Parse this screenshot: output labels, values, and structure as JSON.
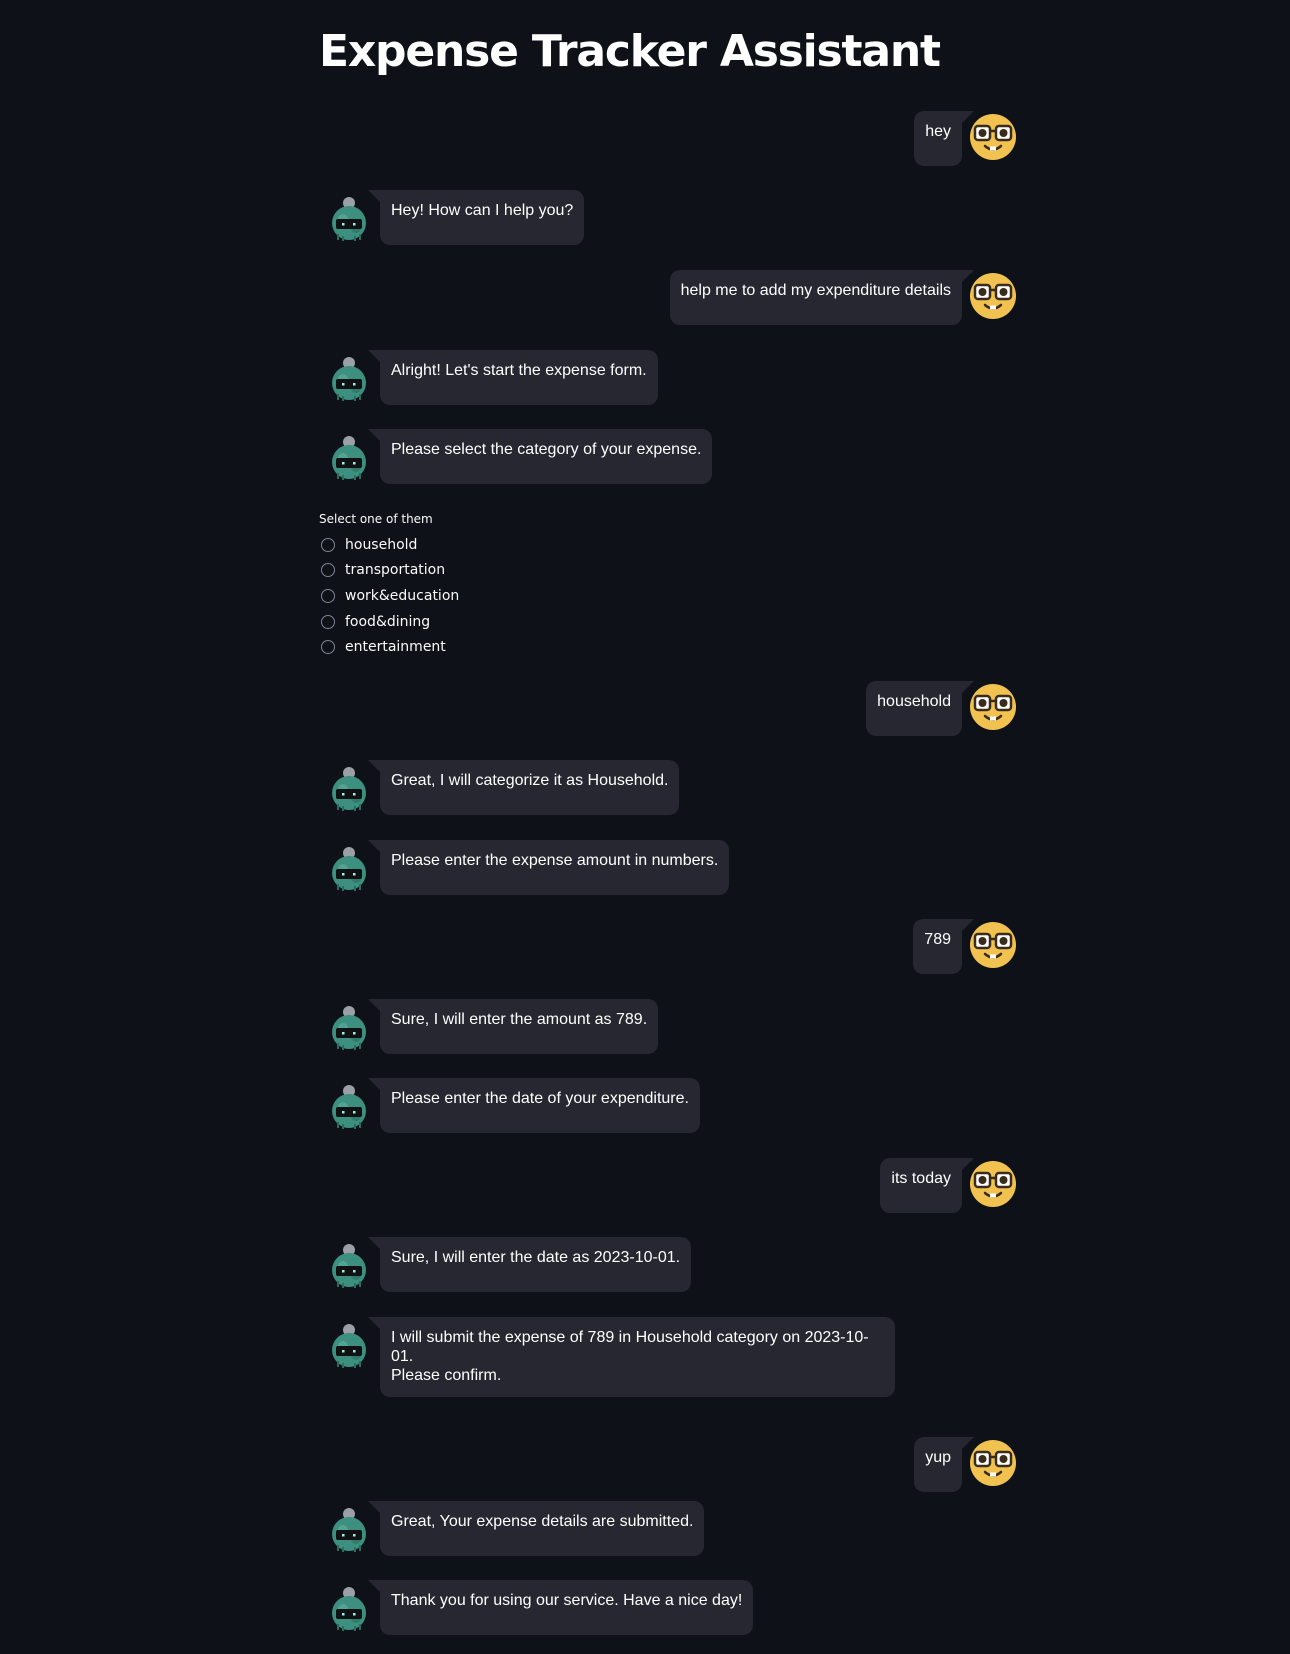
{
  "app": {
    "title": "Expense Tracker Assistant"
  },
  "colors": {
    "background": "#0e1117",
    "bubble": "#262730",
    "text": "#ffffff",
    "user_avatar": "#f1c24f",
    "bot_avatar": "#3d8f7f"
  },
  "messages": [
    {
      "role": "user",
      "text": "hey",
      "avatar": "nerd-face-icon"
    },
    {
      "role": "assistant",
      "text": "Hey! How can I help you?",
      "avatar": "robot-icon"
    },
    {
      "role": "user",
      "text": "help me to add my expenditure details",
      "avatar": "nerd-face-icon"
    },
    {
      "role": "assistant",
      "text": "Alright! Let's start the expense form.",
      "avatar": "robot-icon"
    },
    {
      "role": "assistant",
      "text": "Please select the category of your expense.",
      "avatar": "robot-icon"
    },
    {
      "role": "user",
      "text": "household",
      "avatar": "nerd-face-icon"
    },
    {
      "role": "assistant",
      "text": "Great, I will categorize it as Household.",
      "avatar": "robot-icon"
    },
    {
      "role": "assistant",
      "text": "Please enter the expense amount in numbers.",
      "avatar": "robot-icon"
    },
    {
      "role": "user",
      "text": "789",
      "avatar": "nerd-face-icon"
    },
    {
      "role": "assistant",
      "text": "Sure, I will enter the amount as 789.",
      "avatar": "robot-icon"
    },
    {
      "role": "assistant",
      "text": "Please enter the date of your expenditure.",
      "avatar": "robot-icon"
    },
    {
      "role": "user",
      "text": "its today",
      "avatar": "nerd-face-icon"
    },
    {
      "role": "assistant",
      "text": "Sure, I will enter the date as 2023-10-01.",
      "avatar": "robot-icon"
    },
    {
      "role": "assistant",
      "text": "I will submit the expense of 789 in Household category on 2023-10-01.\nPlease confirm.",
      "avatar": "robot-icon"
    },
    {
      "role": "user",
      "text": "yup",
      "avatar": "nerd-face-icon"
    },
    {
      "role": "assistant",
      "text": "Great, Your expense details are submitted.",
      "avatar": "robot-icon"
    },
    {
      "role": "assistant",
      "text": "Thank you for using our service. Have a nice day!",
      "avatar": "robot-icon"
    }
  ],
  "category_radio": {
    "label": "Select one of them",
    "options": [
      "household",
      "transportation",
      "work&education",
      "food&dining",
      "entertainment"
    ],
    "selected": null
  }
}
